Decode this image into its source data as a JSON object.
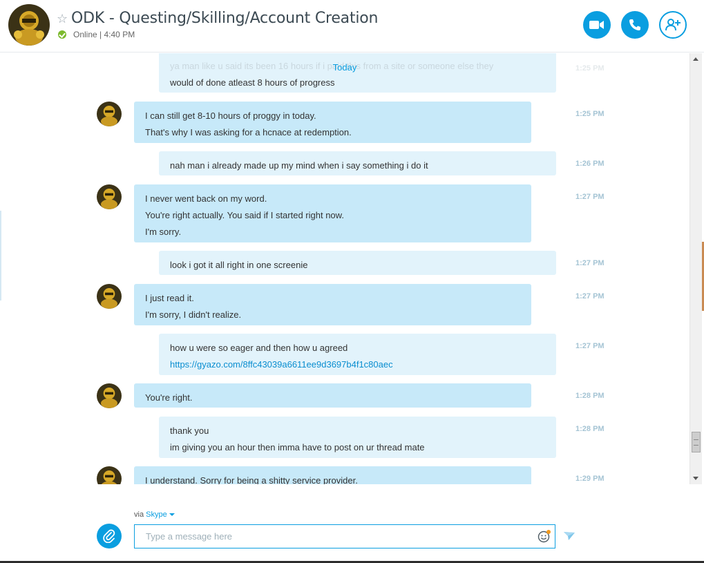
{
  "header": {
    "title": "ODK - Questing/Skilling/Account Creation",
    "status": "Online",
    "separator": "|",
    "time": "4:40 PM"
  },
  "chat": {
    "date_divider": "Today",
    "partial_top": {
      "lines": [
        "ya man like u said its been 16 hours if i paid this from a site or someone else they",
        "would of done atleast 8 hours of progress"
      ],
      "time": "1:25 PM"
    },
    "messages": [
      {
        "dir": "in",
        "lines": [
          "I can still get 8-10 hours of proggy in today.",
          "That's why I was asking for a hcnace at redemption."
        ],
        "time": "1:25 PM"
      },
      {
        "dir": "out",
        "lines": [
          "nah man i already made up my mind when i say something i do it"
        ],
        "time": "1:26 PM"
      },
      {
        "dir": "in",
        "lines": [
          "I never went back on my word.",
          "You're right actually. You said if I started right now.",
          "I'm sorry."
        ],
        "time": "1:27 PM"
      },
      {
        "dir": "out",
        "lines": [
          "look i got it all right in one screenie"
        ],
        "time": "1:27 PM"
      },
      {
        "dir": "in",
        "lines": [
          "I just read it.",
          "I'm sorry, I didn't realize."
        ],
        "time": "1:27 PM"
      },
      {
        "dir": "out",
        "lines": [
          "how u were so eager and then how u agreed"
        ],
        "link": "https://gyazo.com/8ffc43039a6611ee9d3697b4f1c80aec",
        "time": "1:27 PM"
      },
      {
        "dir": "in",
        "lines": [
          "You're right."
        ],
        "time": "1:28 PM"
      },
      {
        "dir": "out",
        "lines": [
          "thank you",
          "im giving you an hour then imma have to post on ur thread mate"
        ],
        "time": "1:28 PM"
      },
      {
        "dir": "in",
        "lines": [
          "I understand. Sorry for being a shitty service provider."
        ],
        "time": "1:29 PM"
      }
    ]
  },
  "compose": {
    "via_label": "via",
    "via_service": "Skype",
    "placeholder": "Type a message here"
  },
  "icons": {
    "video": "video-camera-icon",
    "call": "phone-icon",
    "add_people": "add-person-icon",
    "attach": "paperclip-icon",
    "emoji": "smiley-icon",
    "send": "send-arrow-icon",
    "favorite": "star-icon"
  },
  "colors": {
    "accent": "#0a9ee0",
    "incoming_bubble": "#c7e9f9",
    "outgoing_bubble": "#e2f3fb",
    "online": "#7cba2e"
  }
}
